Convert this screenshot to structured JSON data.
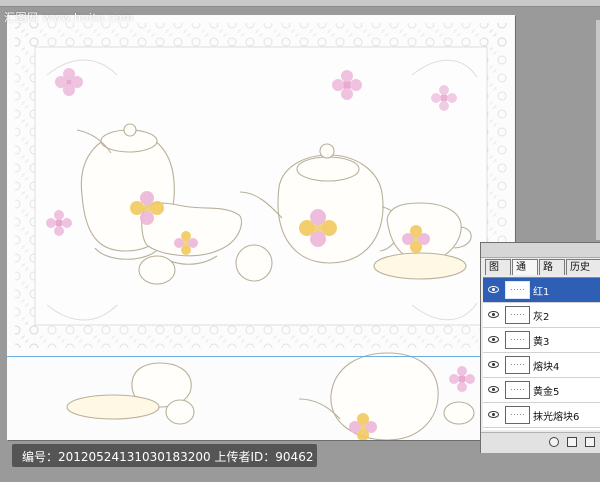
{
  "watermark_top": "汇图网 www.huitu.com",
  "bottom_watermark": "编号：20120524131030183200 上传者ID：90462",
  "layers_panel": {
    "tabs": [
      "图层",
      "通道",
      "路径",
      "历史记"
    ],
    "rows": [
      {
        "name": "红1",
        "selected": true
      },
      {
        "name": "灰2",
        "selected": false
      },
      {
        "name": "黄3",
        "selected": false
      },
      {
        "name": "熔块4",
        "selected": false
      },
      {
        "name": "黄金5",
        "selected": false
      },
      {
        "name": "抹光熔块6",
        "selected": false
      }
    ]
  },
  "colors": {
    "workspace": "#9a9a9a",
    "canvas": "#fbfbfb",
    "selection": "#2f5fb4",
    "pink": "#e6a6cf",
    "gold": "#f0cf72",
    "outline": "#b8b09a"
  }
}
